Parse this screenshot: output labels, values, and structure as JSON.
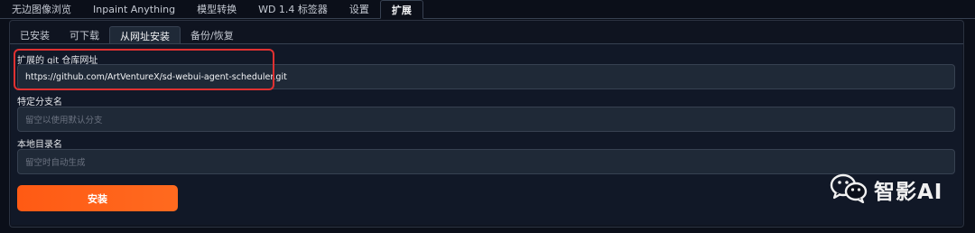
{
  "top_tabs": [
    "无边图像浏览",
    "Inpaint Anything",
    "模型转换",
    "WD 1.4 标签器",
    "设置",
    "扩展"
  ],
  "sub_tabs": [
    "已安装",
    "可下载",
    "从网址安装",
    "备份/恢复"
  ],
  "form": {
    "repo_label": "扩展的 git 仓库网址",
    "repo_value": "https://github.com/ArtVentureX/sd-webui-agent-scheduler.git",
    "branch_label": "特定分支名",
    "branch_placeholder": "留空以使用默认分支",
    "dir_label": "本地目录名",
    "dir_placeholder": "留空时自动生成",
    "install_label": "安装"
  },
  "watermark": {
    "text": "智影AI",
    "icon": "wechat-icon"
  },
  "colors": {
    "accent": "#ff5a14",
    "highlight": "#e03131",
    "background": "#0b0f19"
  }
}
